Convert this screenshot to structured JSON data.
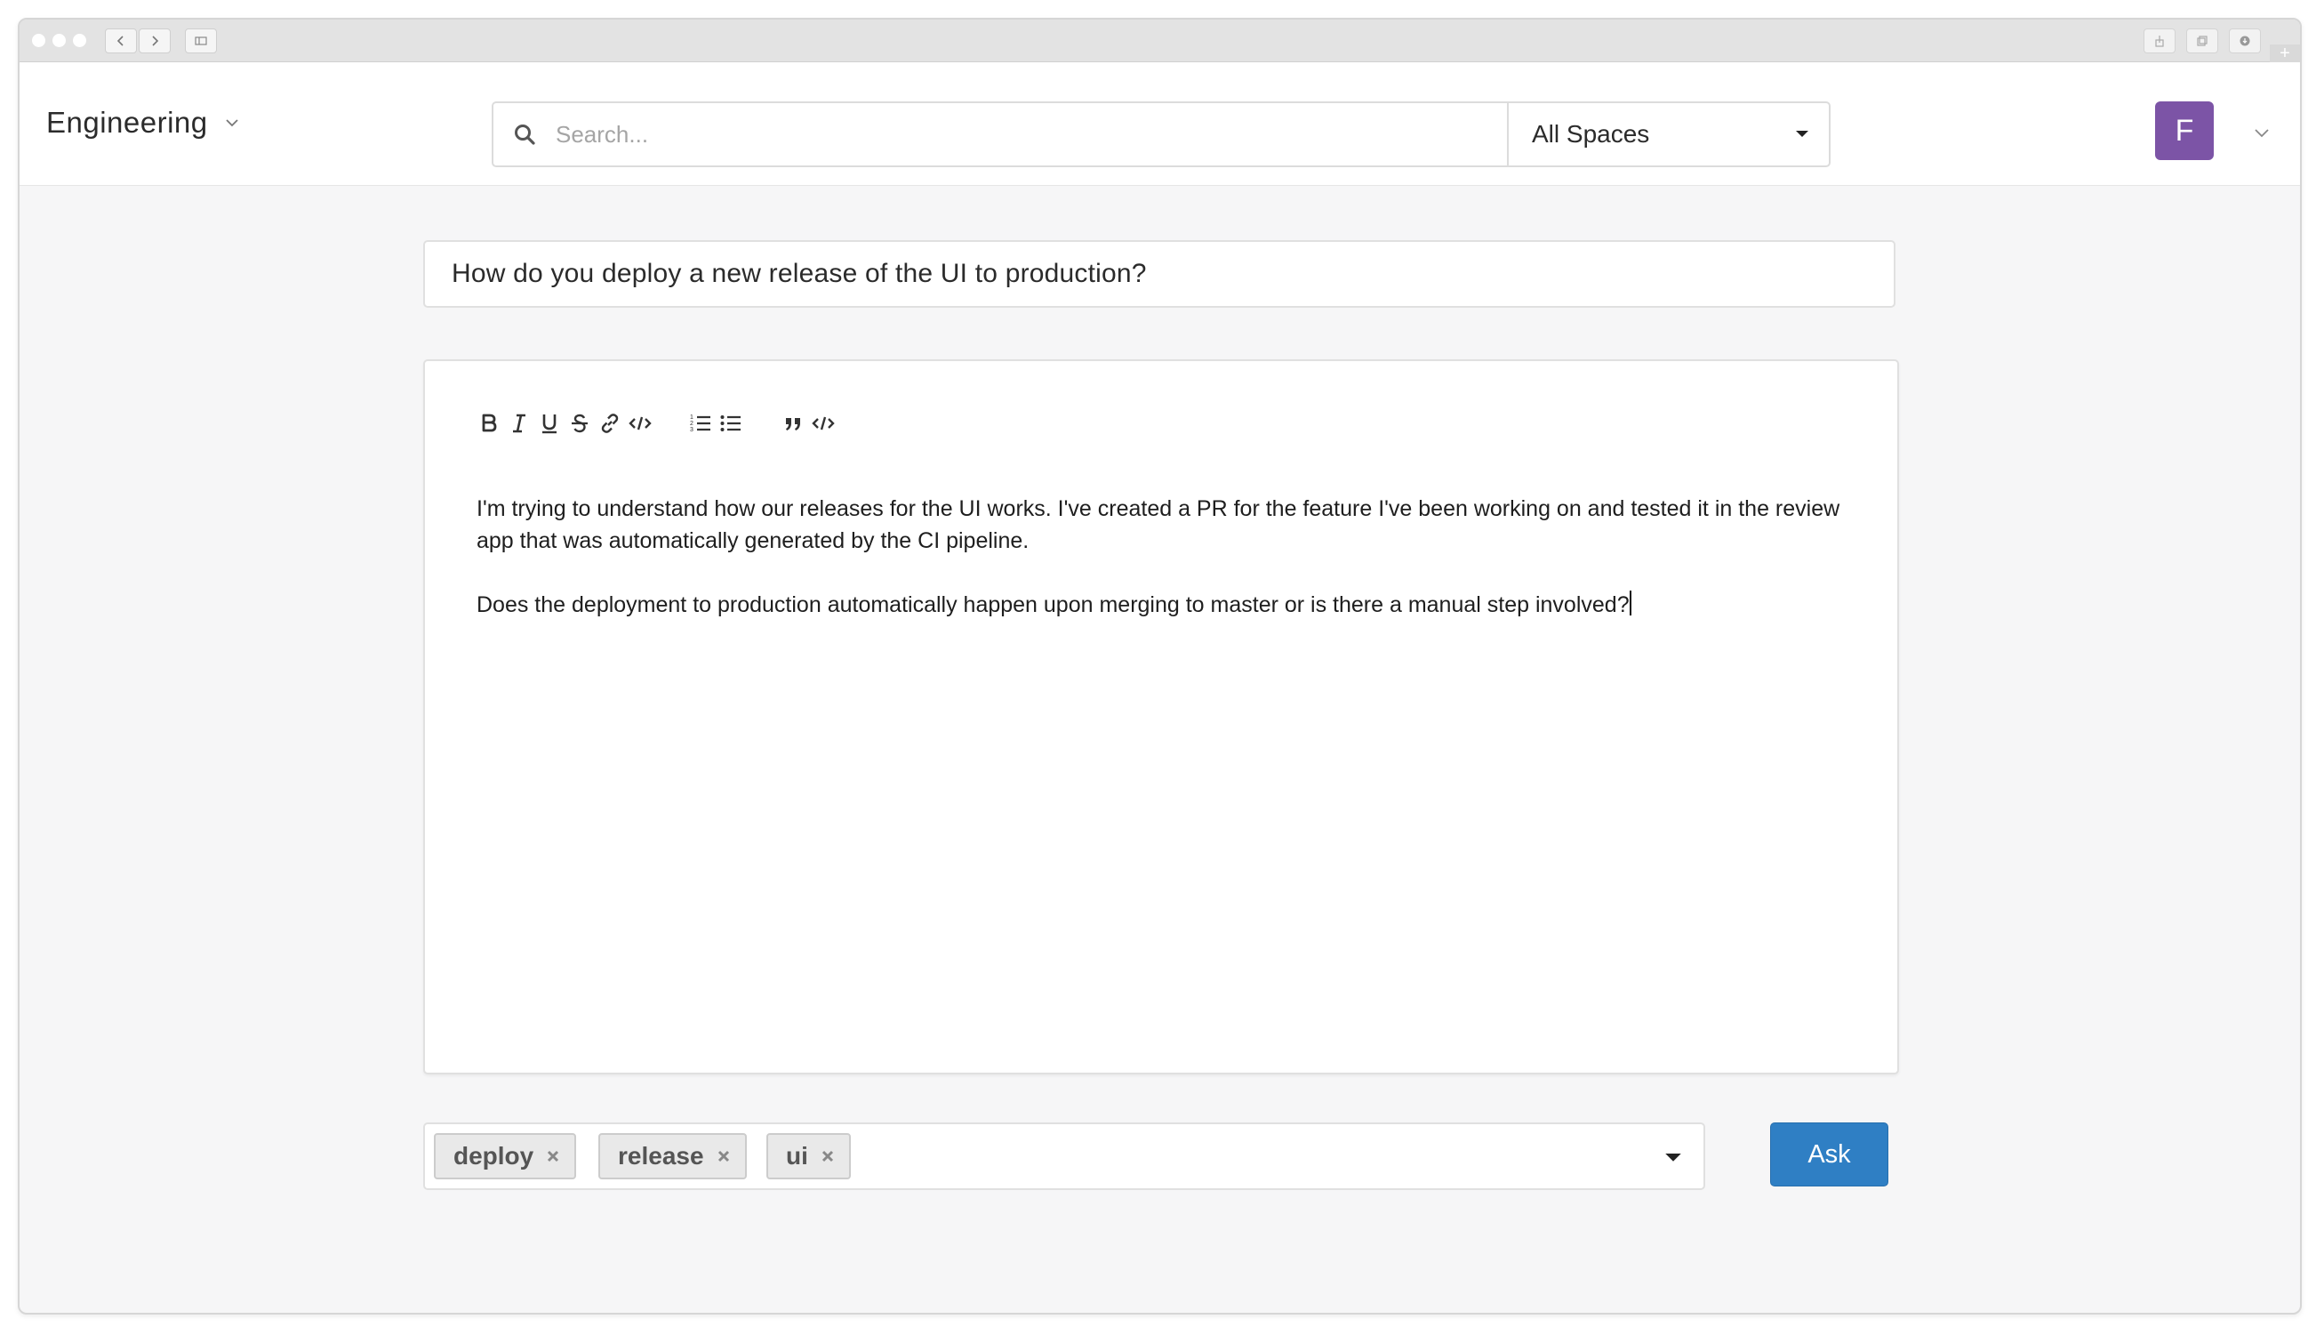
{
  "header": {
    "workspace": "Engineering",
    "search_placeholder": "Search...",
    "spaces_selected": "All Spaces",
    "avatar_initial": "F"
  },
  "question": {
    "title": "How do you deploy a new release of the UI to production?",
    "body": [
      "I'm trying to understand how our releases for the UI works. I've created a PR for the feature I've been working on and tested it in the review app that was automatically generated by the CI pipeline.",
      "Does the deployment to production automatically happen upon merging to master or is there a manual step involved?"
    ]
  },
  "toolbar_icons": [
    "bold-icon",
    "italic-icon",
    "underline-icon",
    "strikethrough-icon",
    "link-icon",
    "inline-code-icon",
    "ordered-list-icon",
    "bullet-list-icon",
    "blockquote-icon",
    "code-block-icon"
  ],
  "tags": [
    "deploy",
    "release",
    "ui"
  ],
  "ask_label": "Ask",
  "colors": {
    "avatar": "#7c54a6",
    "ask_button": "#2f7fc4",
    "page_background": "#f6f6f7"
  }
}
